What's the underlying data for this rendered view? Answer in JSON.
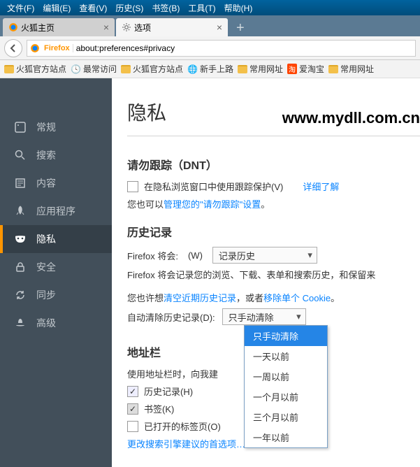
{
  "menubar": [
    "文件(F)",
    "编辑(E)",
    "查看(V)",
    "历史(S)",
    "书签(B)",
    "工具(T)",
    "帮助(H)"
  ],
  "tabs": [
    {
      "label": "火狐主页",
      "active": false
    },
    {
      "label": "选项",
      "active": true
    }
  ],
  "url": {
    "badge": "Firefox",
    "value": "about:preferences#privacy"
  },
  "bookmarks": [
    "火狐官方站点",
    "最常访问",
    "火狐官方站点",
    "新手上路",
    "常用网址",
    "爱淘宝",
    "常用网址"
  ],
  "sidebar": [
    {
      "label": "常规",
      "icon": "general"
    },
    {
      "label": "搜索",
      "icon": "search"
    },
    {
      "label": "内容",
      "icon": "content"
    },
    {
      "label": "应用程序",
      "icon": "apps"
    },
    {
      "label": "隐私",
      "icon": "privacy",
      "selected": true
    },
    {
      "label": "安全",
      "icon": "security"
    },
    {
      "label": "同步",
      "icon": "sync"
    },
    {
      "label": "高级",
      "icon": "advanced"
    }
  ],
  "page": {
    "title": "隐私",
    "watermark": "www.mydll.com.cn",
    "dnt": {
      "heading": "请勿跟踪（DNT）",
      "checkbox": "在隐私浏览窗口中使用跟踪保护(V)",
      "learn": "详细了解",
      "also_pre": "您也可以",
      "also_link": "管理您的\"请勿跟踪\"设置",
      "also_post": "。"
    },
    "history": {
      "heading": "历史记录",
      "will_label": "Firefox 将会:",
      "will_key": "(W)",
      "will_value": "记录历史",
      "desc": "Firefox 将会记录您的浏览、下载、表单和搜索历史，和保留来",
      "maybe_pre": "您也许想",
      "maybe_link1": "清空近期历史记录",
      "maybe_mid": "，或者",
      "maybe_link2": "移除单个 Cookie",
      "maybe_post": "。",
      "auto_label": "自动清除历史记录(D):",
      "auto_value": "只手动清除",
      "options": [
        "只手动清除",
        "一天以前",
        "一周以前",
        "一个月以前",
        "三个月以前",
        "一年以前"
      ]
    },
    "location": {
      "heading": "地址栏",
      "desc": "使用地址栏时，向我建",
      "c1": "历史记录(H)",
      "c2": "书签(K)",
      "c3": "已打开的标签页(O)",
      "link": "更改搜索引擎建议的首选项…"
    }
  }
}
